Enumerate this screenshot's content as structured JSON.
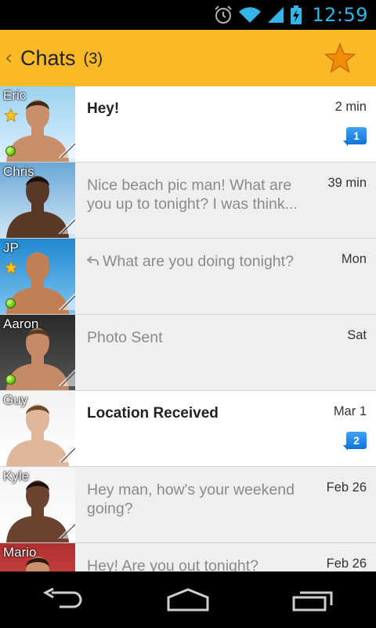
{
  "status_bar": {
    "time": "12:59",
    "icons": [
      "alarm-icon",
      "wifi-icon",
      "signal-icon",
      "battery-charging-icon"
    ],
    "accent_color": "#33b5e5"
  },
  "header": {
    "back_glyph": "‹",
    "title": "Chats",
    "count": "(3)",
    "favorites_icon": "star-icon",
    "background_color": "#fbb928"
  },
  "chats": [
    {
      "name": "Eric",
      "favorite": true,
      "online": true,
      "message": "Hey!",
      "time": "2 min",
      "unread": "1",
      "bold": true,
      "replied": false
    },
    {
      "name": "Chris",
      "favorite": false,
      "online": false,
      "message": "Nice beach pic man! What are you up to tonight? I was think...",
      "time": "39 min",
      "unread": null,
      "bold": false,
      "replied": false
    },
    {
      "name": "JP",
      "favorite": true,
      "online": true,
      "message": "What are you doing tonight?",
      "time": "Mon",
      "unread": null,
      "bold": false,
      "replied": true
    },
    {
      "name": "Aaron",
      "favorite": false,
      "online": true,
      "message": "Photo Sent",
      "time": "Sat",
      "unread": null,
      "bold": false,
      "replied": false
    },
    {
      "name": "Guy",
      "favorite": false,
      "online": false,
      "message": "Location Received",
      "time": "Mar 1",
      "unread": "2",
      "bold": true,
      "replied": false
    },
    {
      "name": "Kyle",
      "favorite": false,
      "online": false,
      "message": "Hey man, how's your weekend going?",
      "time": "Feb 26",
      "unread": null,
      "bold": false,
      "replied": false
    },
    {
      "name": "Mario",
      "favorite": false,
      "online": false,
      "message": "Hey! Are you out tonight?",
      "time": "Feb 26",
      "unread": null,
      "bold": false,
      "replied": false
    }
  ],
  "nav_bar": {
    "buttons": [
      "back-icon",
      "home-icon",
      "recent-apps-icon"
    ]
  }
}
